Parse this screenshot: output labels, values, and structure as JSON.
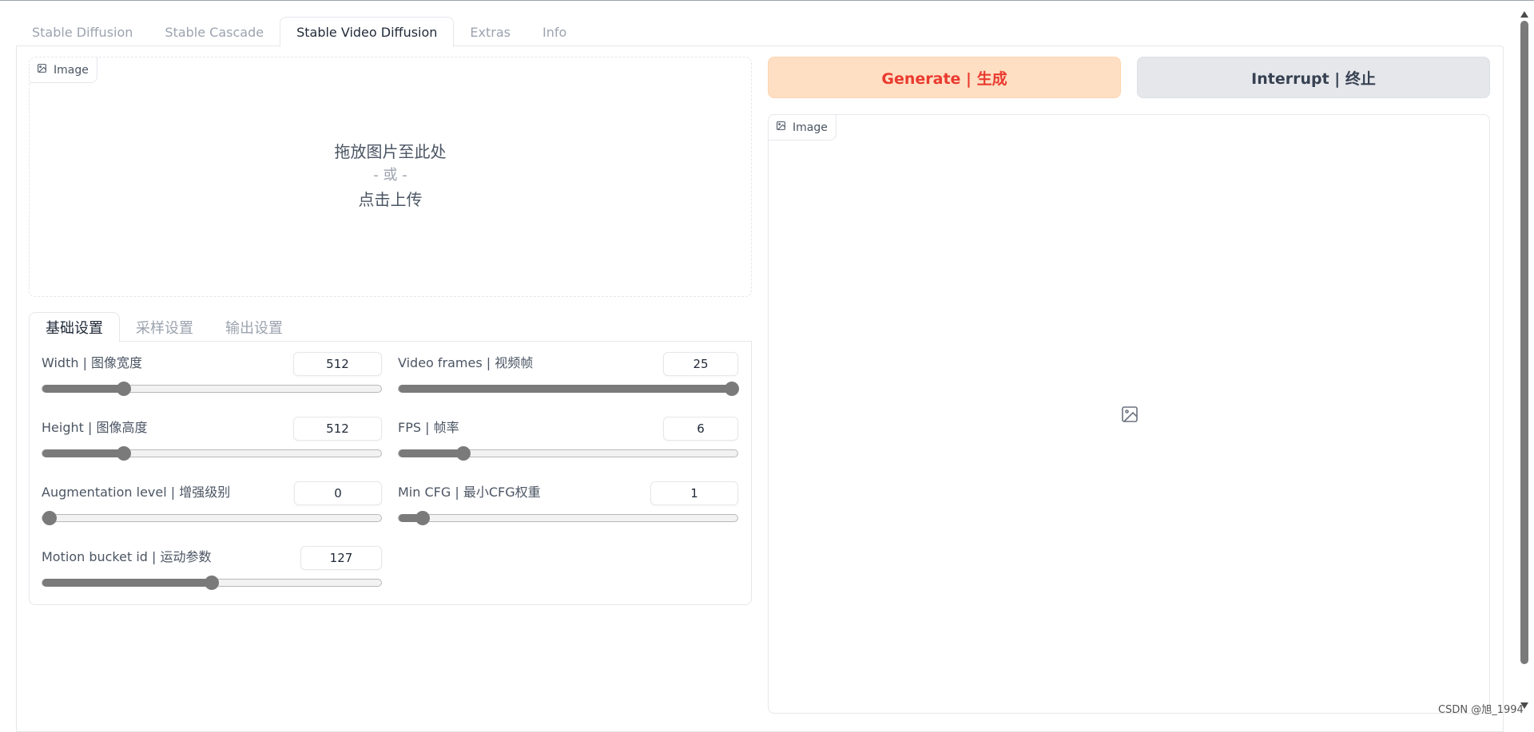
{
  "main_tabs": [
    {
      "label": "Stable Diffusion"
    },
    {
      "label": "Stable Cascade"
    },
    {
      "label": "Stable Video Diffusion"
    },
    {
      "label": "Extras"
    },
    {
      "label": "Info"
    }
  ],
  "active_main_tab": "Stable Video Diffusion",
  "upload": {
    "label": "Image",
    "drop_text": "拖放图片至此处",
    "or_text": "- 或 -",
    "click_text": "点击上传"
  },
  "sub_tabs": [
    {
      "label": "基础设置"
    },
    {
      "label": "采样设置"
    },
    {
      "label": "输出设置"
    }
  ],
  "active_sub_tab": "基础设置",
  "sliders": {
    "width": {
      "label": "Width | 图像宽度",
      "value": "512",
      "fraction": 0.24
    },
    "height": {
      "label": "Height | 图像高度",
      "value": "512",
      "fraction": 0.24
    },
    "augmentation": {
      "label": "Augmentation level | 增强级别",
      "value": "0",
      "fraction": 0.0
    },
    "motion": {
      "label": "Motion bucket id | 运动参数",
      "value": "127",
      "fraction": 0.5
    },
    "video_frames": {
      "label": "Video frames | 视频帧",
      "value": "25",
      "fraction": 1.0
    },
    "fps": {
      "label": "FPS | 帧率",
      "value": "6",
      "fraction": 0.19
    },
    "min_cfg": {
      "label": "Min CFG | 最小CFG权重",
      "value": "1",
      "fraction": 0.07
    }
  },
  "buttons": {
    "generate_label": "Generate | 生成",
    "interrupt_label": "Interrupt | 终止"
  },
  "output": {
    "label": "Image"
  },
  "watermark": "CSDN @旭_1994",
  "colors": {
    "generate_bg": "#fedfc3",
    "generate_text": "#ea3a2f",
    "interrupt_bg": "#e5e7eb",
    "slider_fill": "#7a7a7a"
  },
  "icons": [
    "image-icon",
    "image-placeholder-icon"
  ]
}
